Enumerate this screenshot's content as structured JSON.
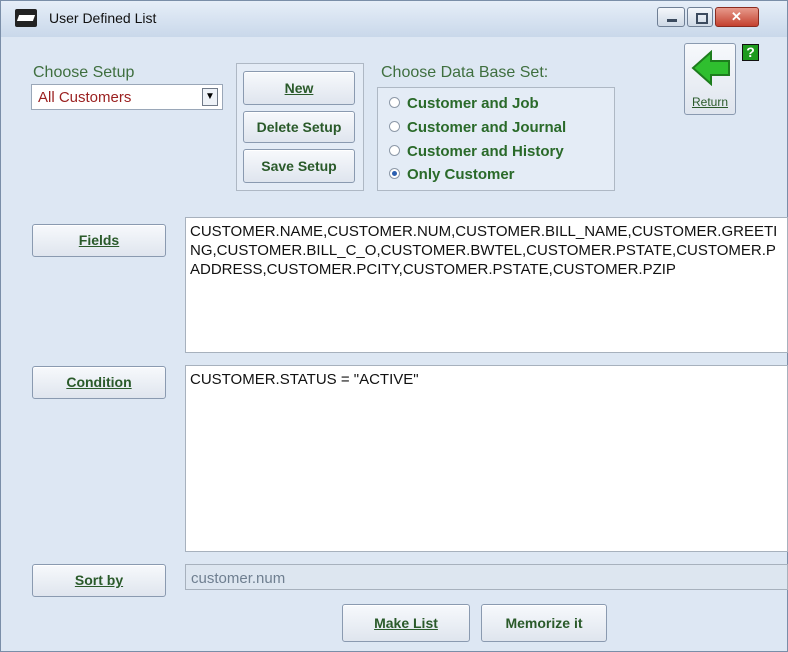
{
  "window": {
    "title": "User Defined List"
  },
  "setup": {
    "label": "Choose Setup",
    "selected": "All Customers",
    "new_label": "New",
    "delete_label": "Delete Setup",
    "save_label": "Save Setup"
  },
  "database": {
    "label": "Choose Data Base Set:",
    "options": [
      {
        "label": "Customer and Job",
        "selected": false
      },
      {
        "label": "Customer and Journal",
        "selected": false
      },
      {
        "label": "Customer and History",
        "selected": false
      },
      {
        "label": "Only Customer",
        "selected": true
      }
    ]
  },
  "return_label": "Return",
  "help_label": "?",
  "fields": {
    "button_label": "Fields",
    "value": "CUSTOMER.NAME,CUSTOMER.NUM,CUSTOMER.BILL_NAME,CUSTOMER.GREETING,CUSTOMER.BILL_C_O,CUSTOMER.BWTEL,CUSTOMER.PSTATE,CUSTOMER.PADDRESS,CUSTOMER.PCITY,CUSTOMER.PSTATE,CUSTOMER.PZIP"
  },
  "condition": {
    "button_label": "Condition",
    "value": "CUSTOMER.STATUS = \"ACTIVE\""
  },
  "sort": {
    "button_label": "Sort by",
    "value": "customer.num"
  },
  "actions": {
    "make_list_label": "Make List",
    "memorize_label": "Memorize it"
  },
  "colors": {
    "accent_text": "#2a5a2a",
    "selection_value": "#9a1f1f",
    "window_bg": "#dde7f3"
  }
}
